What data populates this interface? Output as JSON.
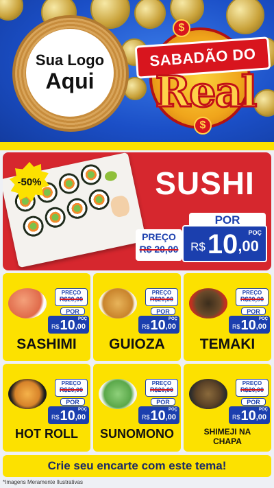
{
  "header": {
    "logo_line1": "Sua Logo",
    "logo_line2": "Aqui",
    "campaign_top": "SABADÃO DO",
    "campaign_main": "Real",
    "currency_symbol": "$"
  },
  "featured": {
    "discount": "-50%",
    "title": "SUSHI",
    "preco_label": "PREÇO",
    "old_price": "R$ 20,00",
    "por_label": "POR",
    "new_currency": "R$",
    "new_price": "10",
    "new_cents": ",00",
    "unit": "POÇ"
  },
  "products": [
    {
      "name": "SASHIMI",
      "preco_label": "PREÇO",
      "old_price": "R$20,00",
      "por_label": "POR",
      "currency": "R$",
      "price": "10",
      "cents": ",00",
      "unit": "POÇ"
    },
    {
      "name": "GUIOZA",
      "preco_label": "PREÇO",
      "old_price": "R$20,00",
      "por_label": "POR",
      "currency": "R$",
      "price": "10",
      "cents": ",00",
      "unit": "POÇ"
    },
    {
      "name": "TEMAKI",
      "preco_label": "PREÇO",
      "old_price": "R$20,00",
      "por_label": "POR",
      "currency": "R$",
      "price": "10",
      "cents": ",00",
      "unit": "POÇ"
    },
    {
      "name": "HOT ROLL",
      "preco_label": "PREÇO",
      "old_price": "R$20,00",
      "por_label": "POR",
      "currency": "R$",
      "price": "10",
      "cents": ",00",
      "unit": "POÇ"
    },
    {
      "name": "SUNOMONO",
      "preco_label": "PREÇO",
      "old_price": "R$20,00",
      "por_label": "POR",
      "currency": "R$",
      "price": "10",
      "cents": ",00",
      "unit": "POÇ"
    },
    {
      "name_line1": "SHIMEJI NA",
      "name_line2": "CHAPA",
      "preco_label": "PREÇO",
      "old_price": "R$20,00",
      "por_label": "POR",
      "currency": "R$",
      "price": "10",
      "cents": ",00",
      "unit": "POÇ"
    }
  ],
  "cta": "Crie seu encarte com este tema!",
  "footer_note": "*Imagens Meramente Ilustrativas",
  "colors": {
    "brand_red": "#d8151e",
    "brand_blue": "#1b3fae",
    "brand_yellow": "#fce100"
  },
  "icons": {
    "coin": "gold-coin-icon",
    "dollar": "dollar-badge-icon"
  }
}
